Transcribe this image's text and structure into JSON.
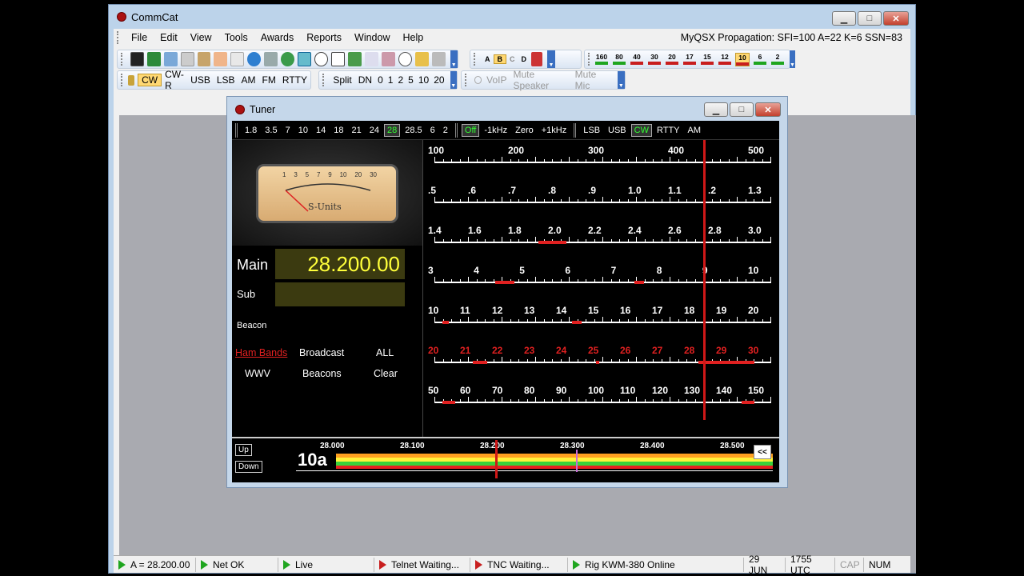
{
  "app": {
    "title": "CommCat"
  },
  "window_buttons": {
    "minimize": "▁",
    "maximize": "□",
    "close": "✕"
  },
  "menu": [
    "File",
    "Edit",
    "View",
    "Tools",
    "Awards",
    "Reports",
    "Window",
    "Help"
  ],
  "propagation": "MyQSX Propagation: SFI=100  A=22  K=6  SSN=83",
  "mode_toolbar": [
    {
      "label": "CW",
      "selected": true
    },
    {
      "label": "CW-R"
    },
    {
      "label": "USB"
    },
    {
      "label": "LSB"
    },
    {
      "label": "AM"
    },
    {
      "label": "FM"
    },
    {
      "label": "RTTY"
    }
  ],
  "split_toolbar": [
    "Split",
    "DN",
    "0",
    "1",
    "2",
    "5",
    "10",
    "20"
  ],
  "voip_toolbar": [
    "VoIP",
    "Mute Speaker",
    "Mute Mic"
  ],
  "vfo_toolbar": [
    "A",
    "B",
    "C",
    "D"
  ],
  "band_toolbar": [
    {
      "label": "160",
      "color": "#1fa51f"
    },
    {
      "label": "80",
      "color": "#1fa51f"
    },
    {
      "label": "40",
      "color": "#c81e1e"
    },
    {
      "label": "30",
      "color": "#c81e1e"
    },
    {
      "label": "20",
      "color": "#c81e1e"
    },
    {
      "label": "17",
      "color": "#c81e1e"
    },
    {
      "label": "15",
      "color": "#c81e1e"
    },
    {
      "label": "12",
      "color": "#c81e1e"
    },
    {
      "label": "10",
      "color": "#c81e1e",
      "selected": true
    },
    {
      "label": "6",
      "color": "#1fa51f"
    },
    {
      "label": "2",
      "color": "#1fa51f"
    }
  ],
  "tuner": {
    "title": "Tuner",
    "bands": [
      "1.8",
      "3.5",
      "7",
      "10",
      "14",
      "18",
      "21",
      "24",
      "28",
      "28.5",
      "6",
      "2"
    ],
    "selected_band": "28",
    "offset": [
      "Off",
      "-1kHz",
      "Zero",
      "+1kHz"
    ],
    "modes": [
      "LSB",
      "USB",
      "CW",
      "RTTY",
      "AM"
    ],
    "selected_mode": "CW",
    "meter_label": "S-Units",
    "meter_scale": [
      "1",
      "3",
      "5",
      "7",
      "9",
      "10",
      "20",
      "30"
    ],
    "main_label": "Main",
    "main_freq": "28.200.00",
    "sub_label": "Sub",
    "beacon_label": "Beacon",
    "links": [
      "Ham Bands",
      "Broadcast",
      "ALL",
      "WWV",
      "Beacons",
      "Clear"
    ],
    "up": "Up",
    "down": "Down",
    "band_name": "10a",
    "bottom_scale": [
      "28.000",
      "28.100",
      "28.200",
      "28.300",
      "28.400",
      "28.500"
    ],
    "collapse": "<<",
    "dial_rows": [
      {
        "labels": [
          "100",
          "200",
          "300",
          "400",
          "500"
        ],
        "color": "#fff"
      },
      {
        "labels": [
          ".5",
          ".6",
          ".7",
          ".8",
          ".9",
          "1.0",
          "1.1",
          ".2",
          "1.3"
        ],
        "color": "#fff"
      },
      {
        "labels": [
          "1.4",
          "1.6",
          "1.8",
          "2.0",
          "2.2",
          "2.4",
          "2.6",
          "2.8",
          "3.0"
        ],
        "color": "#fff"
      },
      {
        "labels": [
          "3",
          "4",
          "5",
          "6",
          "7",
          "8",
          "9",
          "10"
        ],
        "color": "#fff"
      },
      {
        "labels": [
          "10",
          "11",
          "12",
          "13",
          "14",
          "15",
          "16",
          "17",
          "18",
          "19",
          "20"
        ],
        "color": "#fff"
      },
      {
        "labels": [
          "20",
          "21",
          "22",
          "23",
          "24",
          "25",
          "26",
          "27",
          "28",
          "29",
          "30"
        ],
        "color": "#e02020"
      },
      {
        "labels": [
          "50",
          "60",
          "70",
          "80",
          "90",
          "100",
          "110",
          "120",
          "130",
          "140",
          "150"
        ],
        "color": "#fff"
      }
    ]
  },
  "status": [
    {
      "text": "A = 28.200.00",
      "state": "ok"
    },
    {
      "text": "Net OK",
      "state": "ok"
    },
    {
      "text": "Live",
      "state": "ok"
    },
    {
      "text": "Telnet Waiting...",
      "state": "wait"
    },
    {
      "text": "TNC Waiting...",
      "state": "wait"
    },
    {
      "text": "Rig KWM-380 Online",
      "state": "ok"
    }
  ],
  "status_right": [
    "29 JUN",
    "1755 UTC",
    "CAP",
    "NUM"
  ]
}
